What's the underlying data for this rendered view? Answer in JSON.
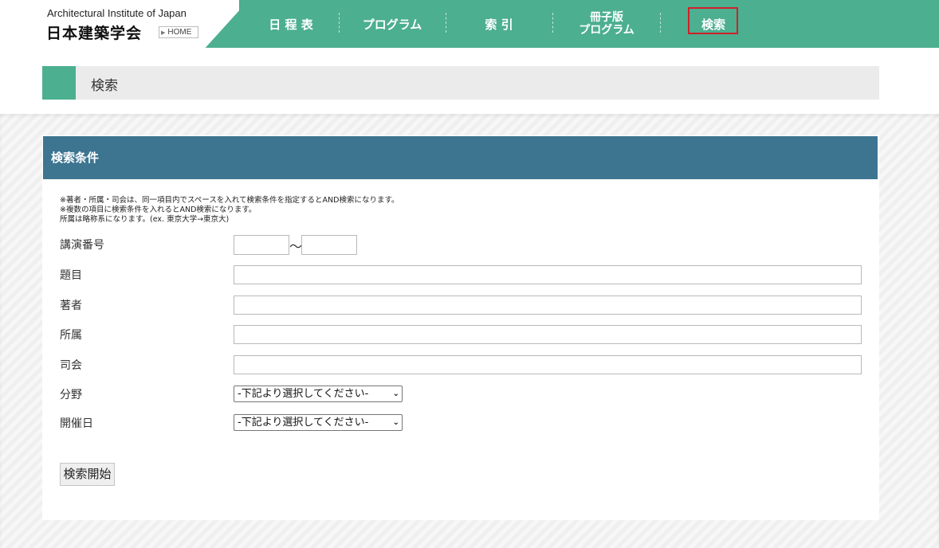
{
  "header": {
    "org_en": "Architectural Institute of Japan",
    "org_jp": "日本建築学会",
    "home_label": "HOME",
    "nav": [
      {
        "label": "日 程 表"
      },
      {
        "label": "プログラム"
      },
      {
        "label": "索 引"
      },
      {
        "label_line1": "冊子版",
        "label_line2": "プログラム"
      },
      {
        "label": "検索",
        "active": true
      }
    ],
    "accent_color": "#4caf8f",
    "active_outline_color": "#d0202a"
  },
  "page_title": "検索",
  "panel": {
    "heading": "検索条件",
    "heading_color": "#3d7591",
    "notes": [
      "※著者・所属・司会は、同一項目内でスペースを入れて検索条件を指定するとAND検索になります。",
      "※複数の項目に検索条件を入れるとAND検索になります。",
      "所属は略称系になります。(ex. 東京大学→東京大)"
    ],
    "fields": {
      "lecture_no_label": "講演番号",
      "lecture_no_from": "",
      "lecture_no_to": "",
      "range_separator": "〜",
      "title_label": "題目",
      "title_value": "",
      "author_label": "著者",
      "author_value": "",
      "affiliation_label": "所属",
      "affiliation_value": "",
      "chair_label": "司会",
      "chair_value": "",
      "field_label": "分野",
      "field_selected": "-下記より選択してください-",
      "date_label": "開催日",
      "date_selected": "-下記より選択してください-"
    },
    "submit_label": "検索開始"
  }
}
